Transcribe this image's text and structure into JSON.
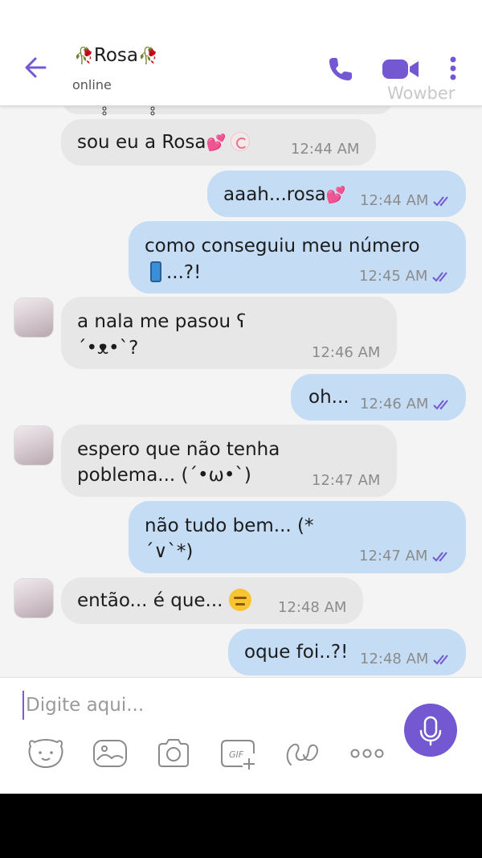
{
  "header": {
    "contact_name": "Rosa",
    "contact_status": "online",
    "watermark": "Wowber",
    "icons": [
      "back-arrow-icon",
      "phone-icon",
      "video-camera-icon",
      "more-vertical-icon"
    ]
  },
  "messages": [
    {
      "direction": "in",
      "text": "sou eu a Rosa",
      "time": "12:44 AM"
    },
    {
      "direction": "out",
      "text": "aaah...rosa",
      "time": "12:44 AM",
      "read": true
    },
    {
      "direction": "out",
      "line1": "como conseguiu meu número",
      "line2": "...?!",
      "time": "12:45 AM",
      "read": true
    },
    {
      "direction": "in",
      "line1": "a nala me pasou ʕ",
      "line2": "´•ᴥ•`?",
      "time": "12:46 AM"
    },
    {
      "direction": "out",
      "text": "oh...",
      "time": "12:46 AM",
      "read": true
    },
    {
      "direction": "in",
      "line1": "espero que não tenha",
      "line2": "poblema... (´•ω•`)",
      "time": "12:47 AM"
    },
    {
      "direction": "out",
      "line1": "não tudo bem... (*",
      "line2": "´∨`*)",
      "time": "12:47 AM",
      "read": true
    },
    {
      "direction": "in",
      "text": "então... é que...",
      "time": "12:48 AM"
    },
    {
      "direction": "out",
      "text": "oque foi..?!",
      "time": "12:48 AM",
      "read": true
    }
  ],
  "composer": {
    "placeholder": "Digite aqui...",
    "tools": [
      "sticker-bear-icon",
      "gallery-icon",
      "camera-icon",
      "gif-icon",
      "doodle-icon",
      "more-horizontal-icon"
    ],
    "gif_label": "GIF"
  },
  "colors": {
    "accent": "#7358d1",
    "incoming_bubble": "#e7e7e7",
    "outgoing_bubble": "#c5dcf5",
    "chat_background": "#f4f4f4"
  }
}
